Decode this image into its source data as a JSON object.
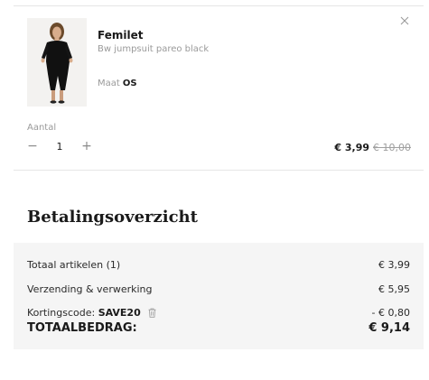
{
  "cart_item": {
    "brand": "Femilet",
    "product_name": "Bw jumpsuit pareo black",
    "size_label": "Maat",
    "size_value": "OS",
    "remove_icon": "close-icon",
    "quantity_label": "Aantal",
    "quantity_value": "1",
    "minus_symbol": "−",
    "plus_symbol": "+",
    "price_now": "€ 3,99",
    "price_old": "€ 10,00"
  },
  "summary": {
    "title": "Betalingsoverzicht",
    "rows": [
      {
        "label": "Totaal artikelen (1)",
        "value": "€ 3,99"
      },
      {
        "label": "Verzending & verwerking",
        "value": "€ 5,95"
      }
    ],
    "discount": {
      "label": "Kortingscode:",
      "code": "SAVE20",
      "value": "- € 0,80",
      "icon": "trash-icon"
    },
    "total_label": "TOTAALBEDRAG:",
    "total_value": "€ 9,14"
  },
  "colors": {
    "text": "#1a1a1a",
    "muted": "#9a9a9a",
    "summary_background": "#f5f5f5",
    "divider": "#e6e6e6"
  }
}
